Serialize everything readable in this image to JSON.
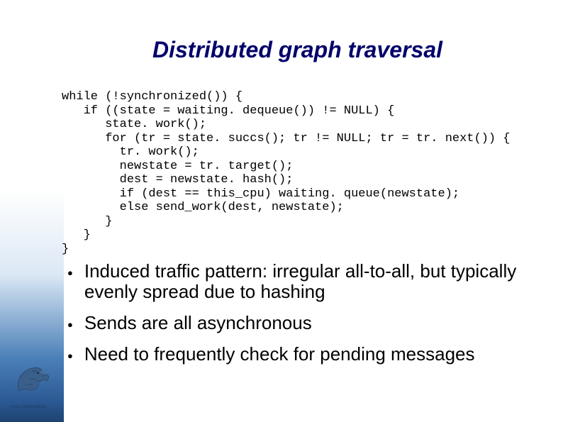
{
  "title": "Distributed graph traversal",
  "code": "while (!synchronized()) {\n   if ((state = waiting. dequeue()) != NULL) {\n      state. work();\n      for (tr = state. succs(); tr != NULL; tr = tr. next()) {\n        tr. work();\n        newstate = tr. target();\n        dest = newstate. hash();\n        if (dest == this_cpu) waiting. queue(newstate);\n        else send_work(dest, newstate);\n      }\n   }\n}",
  "bullets": [
    "Induced traffic pattern: irregular all-to-all, but typically evenly spread due to hashing",
    "Sends are all asynchronous",
    "Need to frequently check for pending messages"
  ],
  "logo_text": "vrije Universiteit"
}
